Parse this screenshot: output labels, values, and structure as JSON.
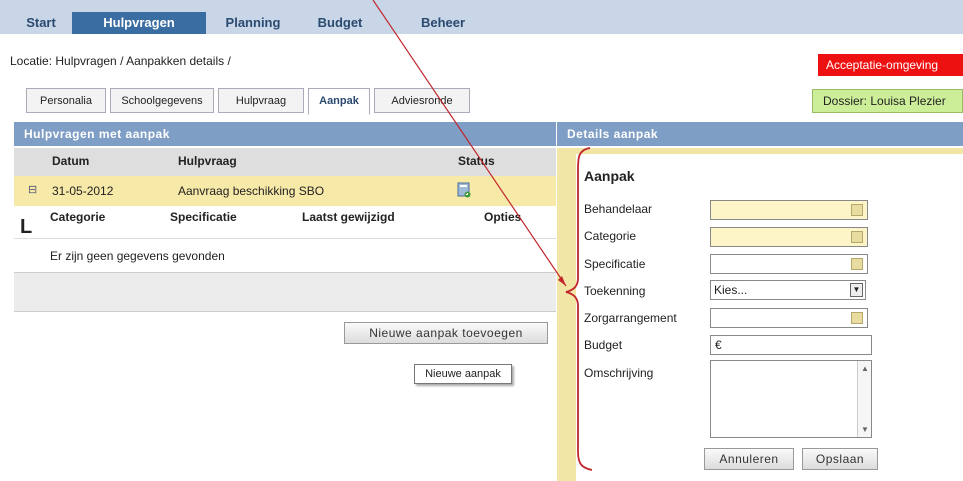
{
  "nav": {
    "items": [
      "Start",
      "Hulpvragen",
      "Planning",
      "Budget",
      "Beheer"
    ],
    "active": "Hulpvragen"
  },
  "location": "Locatie: Hulpvragen / Aanpakken details /",
  "environment_badge": "Acceptatie-omgeving",
  "tabs": [
    "Personalia",
    "Schoolgegevens",
    "Hulpvraag",
    "Aanpak",
    "Adviesronde"
  ],
  "active_tab": "Aanpak",
  "dossier": "Dossier: Louisa Plezier",
  "left_panel": {
    "title": "Hulpvragen met aanpak",
    "columns": [
      "Datum",
      "Hulpvraag",
      "Status"
    ],
    "row": {
      "expander": "⊟",
      "datum": "31-05-2012",
      "hulpvraag": "Aanvraag beschikking SBO"
    },
    "sub_columns": [
      "Categorie",
      "Specificatie",
      "Laatst gewijzigd",
      "Opties"
    ],
    "sub_marker": "L",
    "empty_message": "Er zijn geen gegevens gevonden",
    "add_button": "Nieuwe aanpak toevoegen",
    "tooltip": "Nieuwe aanpak"
  },
  "right_panel": {
    "title": "Details aanpak",
    "form_title": "Aanpak",
    "labels": {
      "behandelaar": "Behandelaar",
      "categorie": "Categorie",
      "specificatie": "Specificatie",
      "toekenning": "Toekenning",
      "zorgarrangement": "Zorgarrangement",
      "budget": "Budget",
      "omschrijving": "Omschrijving"
    },
    "toekenning_value": "Kies...",
    "budget_prefix": "€",
    "cancel_button": "Annuleren",
    "save_button": "Opslaan"
  },
  "colors": {
    "nav_bg": "#c8d6e8",
    "nav_active": "#3a6da2",
    "panel_header": "#7f9ec5",
    "selected_row": "#f7e9a8",
    "badge_red": "#ee1111",
    "dossier_green": "#ccee99",
    "annotation_red": "#c0262c"
  }
}
